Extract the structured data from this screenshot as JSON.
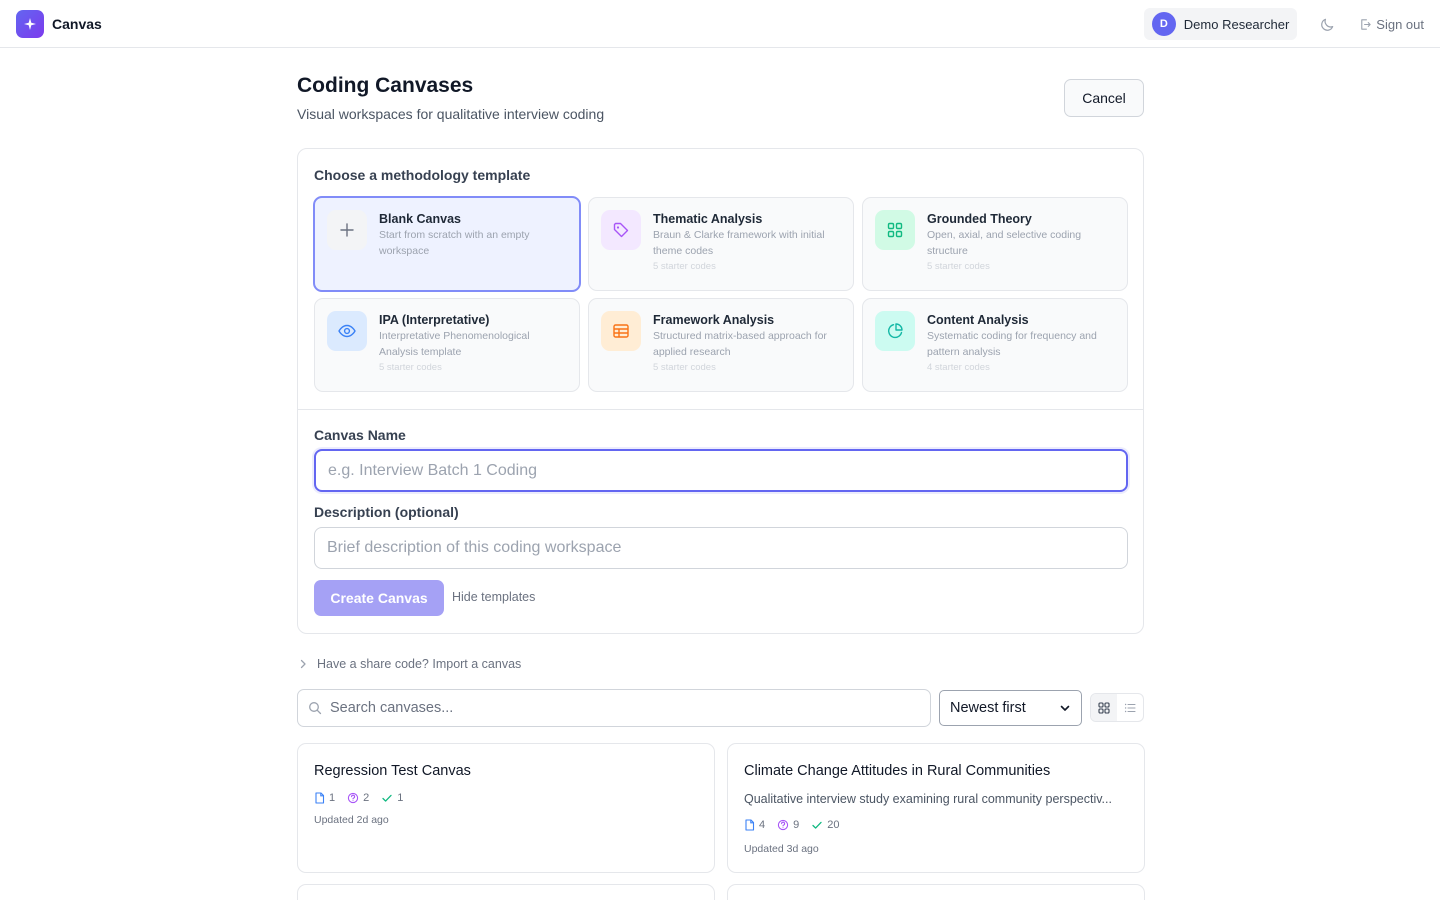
{
  "app": {
    "title": "Canvas"
  },
  "user": {
    "initial": "D",
    "name": "Demo Researcher"
  },
  "header": {
    "sign_out": "Sign out"
  },
  "page": {
    "title": "Coding Canvases",
    "subtitle": "Visual workspaces for qualitative interview coding",
    "cancel_label": "Cancel"
  },
  "create": {
    "section_label": "Choose a methodology template",
    "templates": [
      {
        "title": "Blank Canvas",
        "desc": "Start from scratch with an empty workspace",
        "codes": "",
        "icon": "plus-icon",
        "selected": true
      },
      {
        "title": "Thematic Analysis",
        "desc": "Braun & Clarke framework with initial theme codes",
        "codes": "5 starter codes",
        "icon": "tag-icon"
      },
      {
        "title": "Grounded Theory",
        "desc": "Open, axial, and selective coding structure",
        "codes": "5 starter codes",
        "icon": "grid-icon"
      },
      {
        "title": "IPA (Interpretative)",
        "desc": "Interpretative Phenomenological Analysis template",
        "codes": "5 starter codes",
        "icon": "eye-icon"
      },
      {
        "title": "Framework Analysis",
        "desc": "Structured matrix-based approach for applied research",
        "codes": "5 starter codes",
        "icon": "table-icon"
      },
      {
        "title": "Content Analysis",
        "desc": "Systematic coding for frequency and pattern analysis",
        "codes": "4 starter codes",
        "icon": "pie-chart-icon"
      }
    ],
    "name_label": "Canvas Name",
    "name_placeholder": "e.g. Interview Batch 1 Coding",
    "desc_label": "Description (optional)",
    "desc_placeholder": "Brief description of this coding workspace",
    "create_label": "Create Canvas",
    "hide_templates": "Hide templates"
  },
  "import": {
    "label": "Have a share code? Import a canvas"
  },
  "toolbar": {
    "search_placeholder": "Search canvases...",
    "sort_selected": "Newest first"
  },
  "canvases": [
    {
      "title": "Regression Test Canvas",
      "desc": "",
      "docs": "1",
      "questions": "2",
      "codes": "1",
      "updated": "Updated 2d ago"
    },
    {
      "title": "Climate Change Attitudes in Rural Communities",
      "desc": "Qualitative interview study examining rural community perspectiv...",
      "docs": "4",
      "questions": "9",
      "codes": "20",
      "updated": "Updated 3d ago"
    }
  ],
  "colors": {
    "accent": "#6366f1",
    "selected_border": "#818cf8",
    "create_button": "#a5a1f5"
  }
}
